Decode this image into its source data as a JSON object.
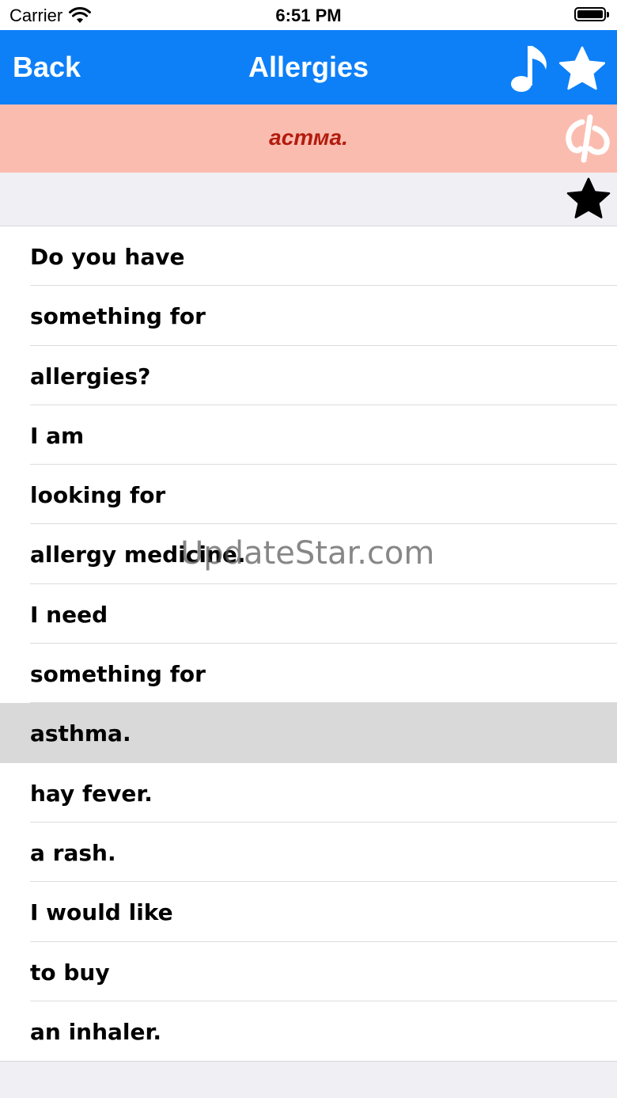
{
  "status_bar": {
    "carrier": "Carrier",
    "time": "6:51 PM"
  },
  "nav": {
    "back_label": "Back",
    "title": "Allergies",
    "music_icon": "music-note-icon",
    "favorite_icon": "star-icon"
  },
  "translation": {
    "text": "астма.",
    "logo_icon": "phi-logo-icon"
  },
  "favorite_bar": {
    "icon": "star-icon"
  },
  "phrases": [
    "Do you have",
    "something for",
    "allergies?",
    "I am",
    "looking for",
    "allergy medicine.",
    "I need",
    "something for",
    "asthma.",
    "hay fever.",
    "a rash.",
    "I would like",
    "to buy",
    "an inhaler."
  ],
  "selected_index": 8,
  "watermark": "UpdateStar.com",
  "colors": {
    "nav_blue": "#0d80f8",
    "banner_pink": "#fbbcb0",
    "translation_red": "#b21c0e",
    "selected_row": "#d9d9d9"
  }
}
